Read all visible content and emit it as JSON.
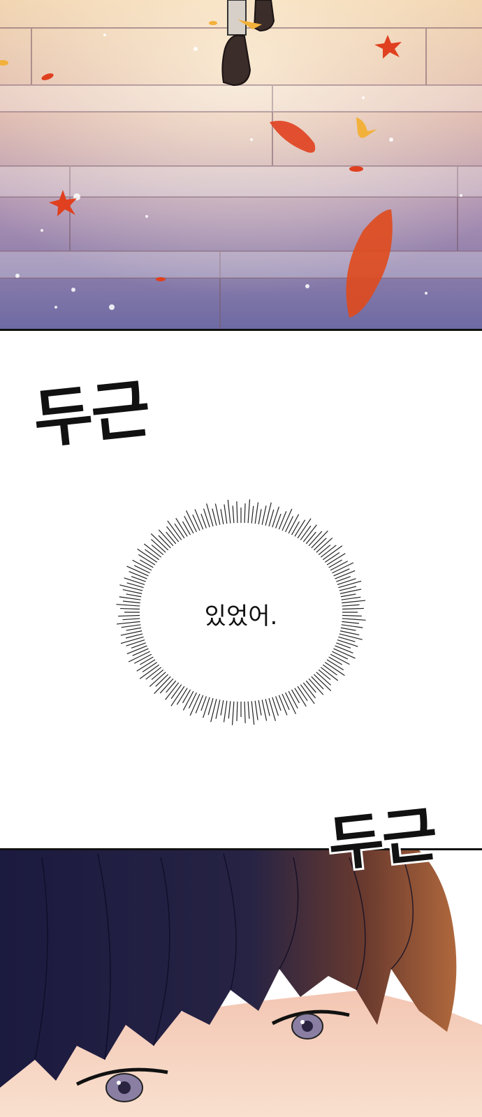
{
  "sound_effects": [
    {
      "text": "두근"
    },
    {
      "text": "두근"
    }
  ],
  "speech_bubble": {
    "text": "있었어."
  },
  "panels": {
    "top": {
      "subject": "stone-stairs-with-autumn-leaves"
    },
    "bottom": {
      "subject": "dark-haired-character-eyes-closeup"
    }
  },
  "colors": {
    "stair_light": "#e9c8a4",
    "stair_mid": "#b98fa0",
    "stair_dark": "#6f6aa0",
    "leaf_red": "#e0401f",
    "leaf_yellow": "#f2b13a",
    "hair_dark": "#1a1a3e",
    "hair_brown": "#8a4a2a",
    "skin": "#f6d7c4",
    "eye": "#8a7fa3"
  }
}
